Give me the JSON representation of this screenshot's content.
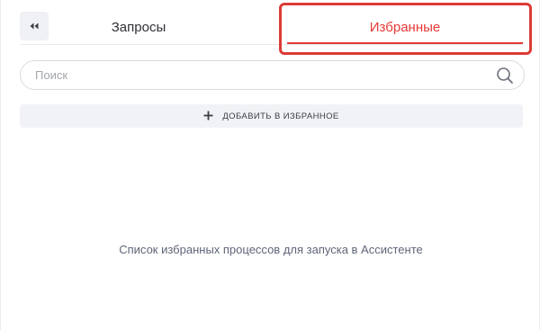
{
  "tabs": {
    "collapse_icon": "double-chevron-left-icon",
    "requests_label": "Запросы",
    "favorites_label": "Избранные",
    "active_tab": "favorites"
  },
  "search": {
    "placeholder": "Поиск",
    "value": "",
    "icon": "search-icon"
  },
  "add_button": {
    "icon": "plus-icon",
    "label": "ДОБАВИТЬ В ИЗБРАННОЕ"
  },
  "empty_state": {
    "message": "Список избранных процессов для запуска в Ассистенте"
  },
  "colors": {
    "accent": "#e53935",
    "highlight": "#dc3b37",
    "muted_text": "#5f6579"
  }
}
